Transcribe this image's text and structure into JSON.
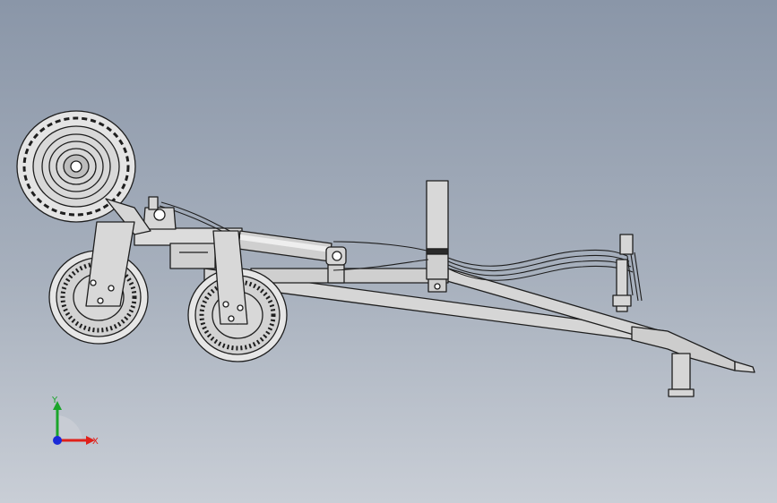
{
  "viewport": {
    "background_top": "#8a96a8",
    "background_bottom": "#c9ced6"
  },
  "triad": {
    "x_label": "X",
    "y_label": "Y",
    "x_color": "#e0201a",
    "y_color": "#1aa52a",
    "z_color": "#1a2ad8"
  },
  "model": {
    "line_color": "#1e1e1e",
    "face_color": "#d6d6d6",
    "face_shadow": "#b9b9b9",
    "band_color": "#2a2a2a",
    "icon": "trailer-cad-model"
  }
}
